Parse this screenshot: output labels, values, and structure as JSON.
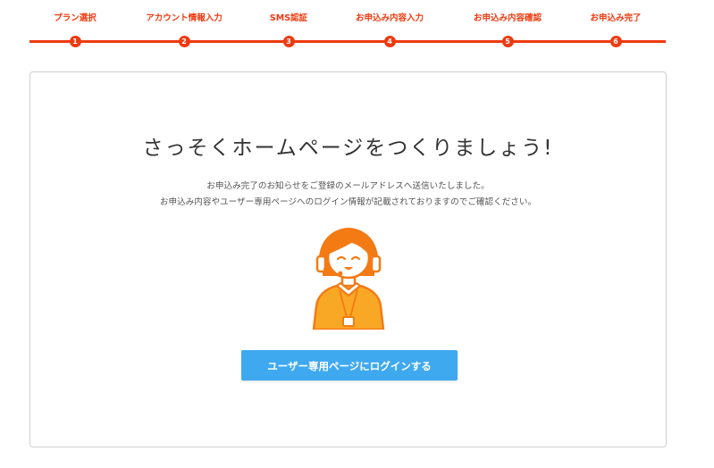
{
  "steps": [
    {
      "label": "プラン選択",
      "number": "1"
    },
    {
      "label": "アカウント情報入力",
      "number": "2"
    },
    {
      "label": "SMS認証",
      "number": "3"
    },
    {
      "label": "お申込み内容入力",
      "number": "4"
    },
    {
      "label": "お申込み内容確認",
      "number": "5"
    },
    {
      "label": "お申込み完了",
      "number": "6"
    }
  ],
  "main": {
    "heading": "さっそくホームページをつくりましょう!",
    "description_line1": "お申込み完了のお知らせをご登録のメールアドレスへ送信いたしました。",
    "description_line2": "お申込み内容やユーザー専用ページへのログイン情報が記載されておりますのでご確認ください。",
    "illustration_icon": "support-operator-icon",
    "login_button_label": "ユーザー専用ページにログインする"
  },
  "colors": {
    "accent": "#ee3a10",
    "button": "#3fa9f0",
    "operator_hair": "#f47a14",
    "operator_shirt": "#f9a825"
  }
}
